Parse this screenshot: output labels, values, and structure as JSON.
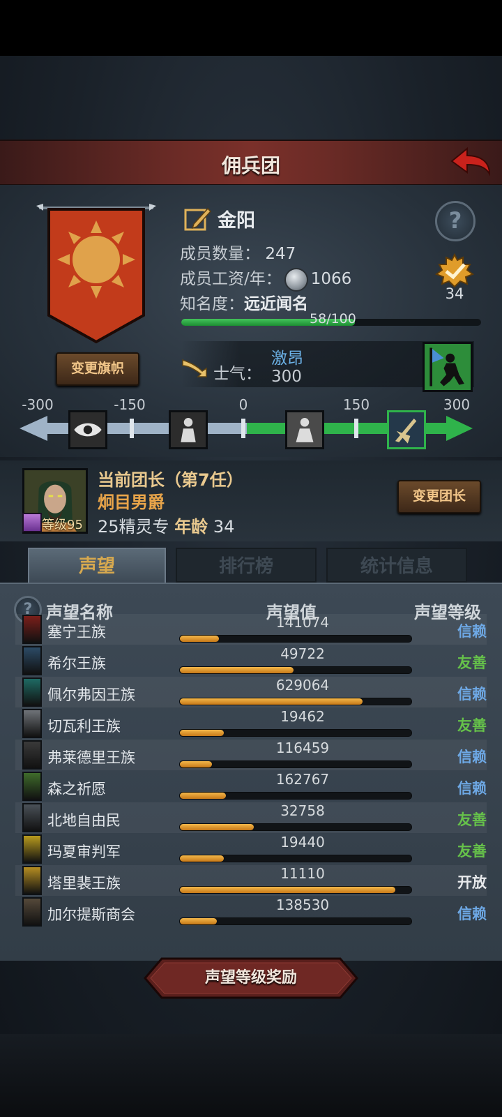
{
  "header": {
    "title": "佣兵团"
  },
  "guild": {
    "name": "金阳",
    "member_count_label": "成员数量：",
    "member_count": "247",
    "wage_label": "成员工资/年：",
    "wage": "1066",
    "fame_label": "知名度：",
    "fame_value": "远近闻名",
    "fame_progress_text": "58/100",
    "fame_progress": 0.58,
    "rank": "34",
    "change_flag_label": "变更旗帜"
  },
  "morale": {
    "label": "士气：",
    "state": "激昂",
    "value": "300",
    "scale_ticks": [
      "-300",
      "-150",
      "0",
      "150",
      "300"
    ]
  },
  "leader": {
    "title": "当前团长（第7任）",
    "name": "炯目男爵",
    "class": "25精灵专",
    "age_label": "年龄",
    "age": "34",
    "level_text": "等级95",
    "change_label": "变更团长"
  },
  "tabs": [
    {
      "label": "声望",
      "active": true
    },
    {
      "label": "排行榜",
      "active": false
    },
    {
      "label": "统计信息",
      "active": false
    }
  ],
  "reputation": {
    "columns": {
      "name": "声望名称",
      "value": "声望值",
      "level": "声望等级"
    },
    "rows": [
      {
        "name": "塞宁王族",
        "value": "141074",
        "level": "信赖",
        "progress": 0.17,
        "icon": "red-sword-crest-icon",
        "iconColor": "#7b1f1a",
        "levelColor": "#6ea9e6"
      },
      {
        "name": "希尔王族",
        "value": "49722",
        "level": "友善",
        "progress": 0.49,
        "icon": "blue-helm-crest-icon",
        "iconColor": "#2c4b66",
        "levelColor": "#66c24a"
      },
      {
        "name": "佩尔弗因王族",
        "value": "629064",
        "level": "信赖",
        "progress": 0.79,
        "icon": "teal-moon-crest-icon",
        "iconColor": "#1e6a63",
        "levelColor": "#6ea9e6"
      },
      {
        "name": "切瓦利王族",
        "value": "19462",
        "level": "友善",
        "progress": 0.19,
        "icon": "scales-crest-icon",
        "iconColor": "#6f7378",
        "levelColor": "#66c24a"
      },
      {
        "name": "弗莱德里王族",
        "value": "116459",
        "level": "信赖",
        "progress": 0.14,
        "icon": "dark-skull-crest-icon",
        "iconColor": "#3a3a3a",
        "levelColor": "#6ea9e6"
      },
      {
        "name": "森之祈愿",
        "value": "162767",
        "level": "信赖",
        "progress": 0.2,
        "icon": "green-tree-crest-icon",
        "iconColor": "#3f6b2b",
        "levelColor": "#6ea9e6"
      },
      {
        "name": "北地自由民",
        "value": "32758",
        "level": "友善",
        "progress": 0.32,
        "icon": "gray-axe-crest-icon",
        "iconColor": "#4a5158",
        "levelColor": "#66c24a"
      },
      {
        "name": "玛夏审判军",
        "value": "19440",
        "level": "友善",
        "progress": 0.19,
        "icon": "yellow-cross-crest-icon",
        "iconColor": "#b99b1e",
        "levelColor": "#66c24a"
      },
      {
        "name": "塔里裴王族",
        "value": "11110",
        "level": "开放",
        "progress": 0.93,
        "icon": "gold-flame-crest-icon",
        "iconColor": "#b58d22",
        "levelColor": "#e8eaec"
      },
      {
        "name": "加尔提斯商会",
        "value": "138530",
        "level": "信赖",
        "progress": 0.16,
        "icon": "chest-crest-icon",
        "iconColor": "#55493a",
        "levelColor": "#6ea9e6"
      }
    ]
  },
  "footer": {
    "reward_label": "声望等级奖励"
  },
  "colors": {
    "accent_gold": "#e9a54a",
    "morale_green": "#2fb34b",
    "trust_blue": "#6ea9e6",
    "friendly_green": "#66c24a"
  }
}
